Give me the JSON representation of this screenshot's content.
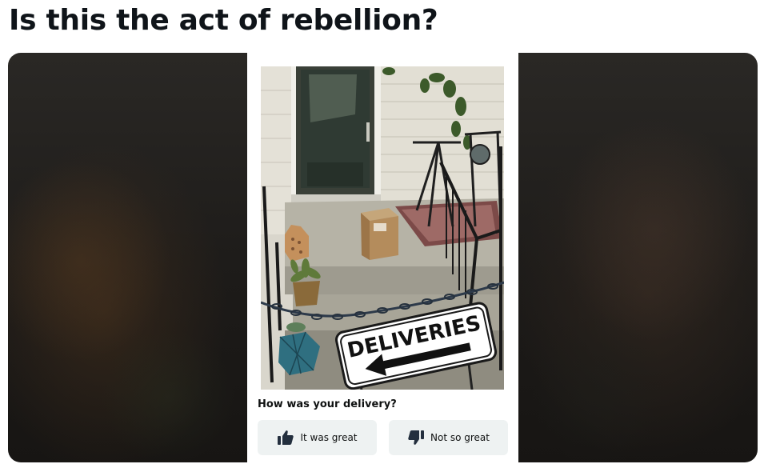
{
  "post": {
    "title": "Is this the act of rebellion?"
  },
  "media": {
    "card": {
      "photo_sign_text": "DELIVERIES",
      "question": "How was your delivery?",
      "buttons": {
        "great": {
          "label": "It was great",
          "icon": "thumbs-up-icon"
        },
        "not_great": {
          "label": "Not so great",
          "icon": "thumbs-down-icon"
        }
      }
    }
  },
  "colors": {
    "title_text": "#0f1419",
    "card_background": "#ffffff",
    "button_background": "#eef2f2",
    "frame_background": "#1d1b19"
  }
}
